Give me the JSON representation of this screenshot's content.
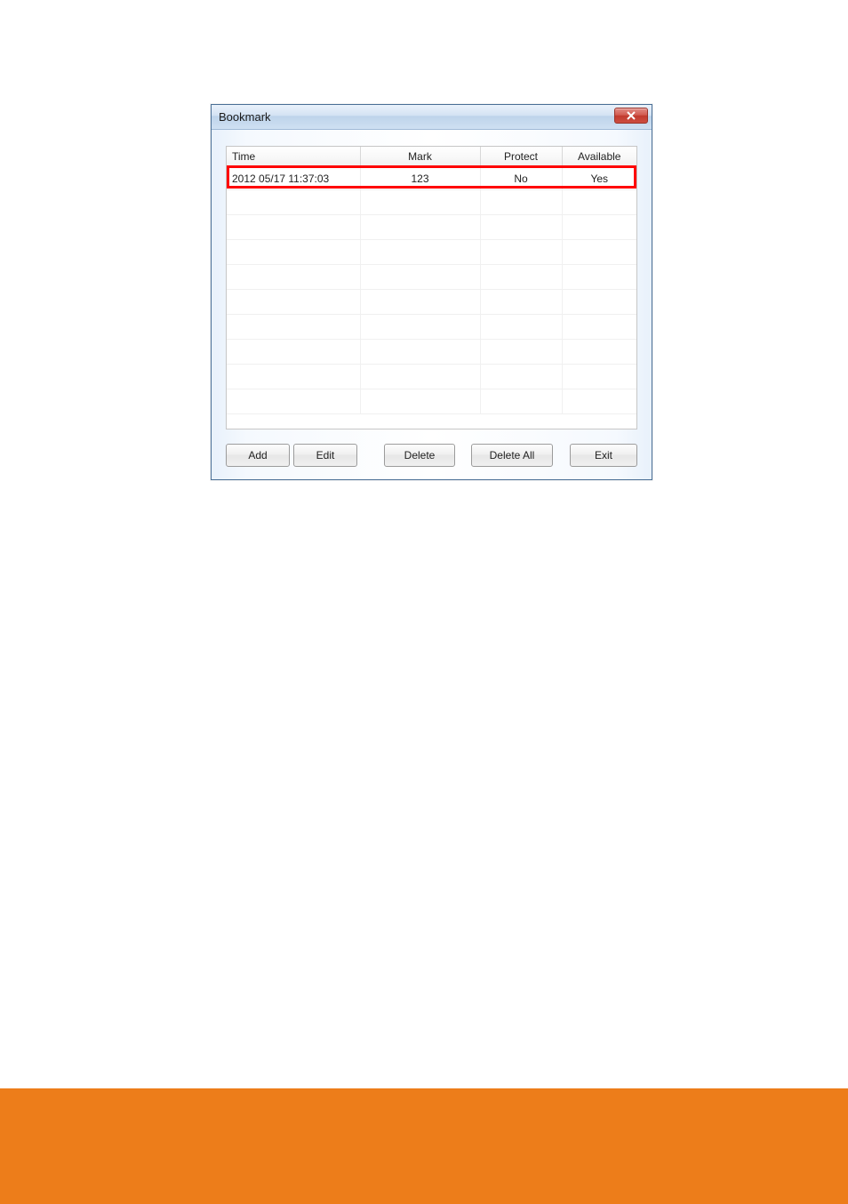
{
  "dialog": {
    "title": "Bookmark"
  },
  "table": {
    "headers": {
      "time": "Time",
      "mark": "Mark",
      "protect": "Protect",
      "available": "Available"
    },
    "rows": [
      {
        "time": "2012 05/17 11:37:03",
        "mark": "123",
        "protect": "No",
        "available": "Yes"
      }
    ]
  },
  "buttons": {
    "add": "Add",
    "edit": "Edit",
    "delete": "Delete",
    "delete_all": "Delete All",
    "exit": "Exit"
  }
}
